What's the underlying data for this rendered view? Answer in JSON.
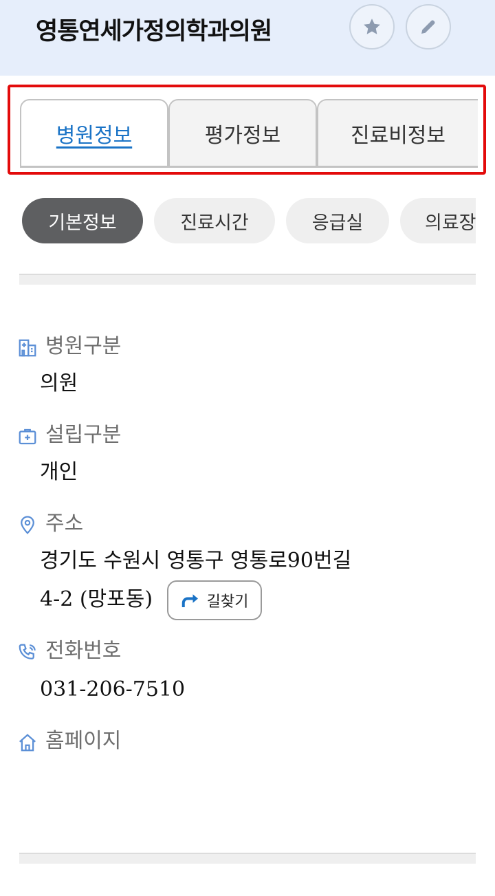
{
  "header": {
    "title": "영통연세가정의학과의원",
    "favorite_icon": "star-icon",
    "edit_icon": "pencil-icon"
  },
  "tabs": [
    {
      "label": "병원정보",
      "active": true
    },
    {
      "label": "평가정보",
      "active": false
    },
    {
      "label": "진료비정보",
      "active": false
    }
  ],
  "chips": [
    {
      "label": "기본정보",
      "active": true
    },
    {
      "label": "진료시간",
      "active": false
    },
    {
      "label": "응급실",
      "active": false
    },
    {
      "label": "의료장",
      "active": false
    }
  ],
  "fields": {
    "category": {
      "label": "병원구분",
      "value": "의원",
      "icon": "hospital-building-icon"
    },
    "establishment": {
      "label": "설립구분",
      "value": "개인",
      "icon": "medical-kit-icon"
    },
    "address": {
      "label": "주소",
      "line1": "경기도 수원시 영통구 영통로90번길",
      "line2": "4-2 (망포동)",
      "icon": "location-pin-icon"
    },
    "phone": {
      "label": "전화번호",
      "value": "031-206-7510",
      "icon": "phone-icon"
    },
    "homepage": {
      "label": "홈페이지",
      "icon": "home-icon"
    }
  },
  "route_button": {
    "label": "길찾기",
    "icon": "turn-right-arrow-icon"
  },
  "colors": {
    "header_bg": "#e6eefb",
    "highlight_border": "#e30b0b",
    "active_tab_text": "#1a73c6",
    "active_chip_bg": "#5e5f61",
    "field_icon": "#5b8fd6"
  }
}
